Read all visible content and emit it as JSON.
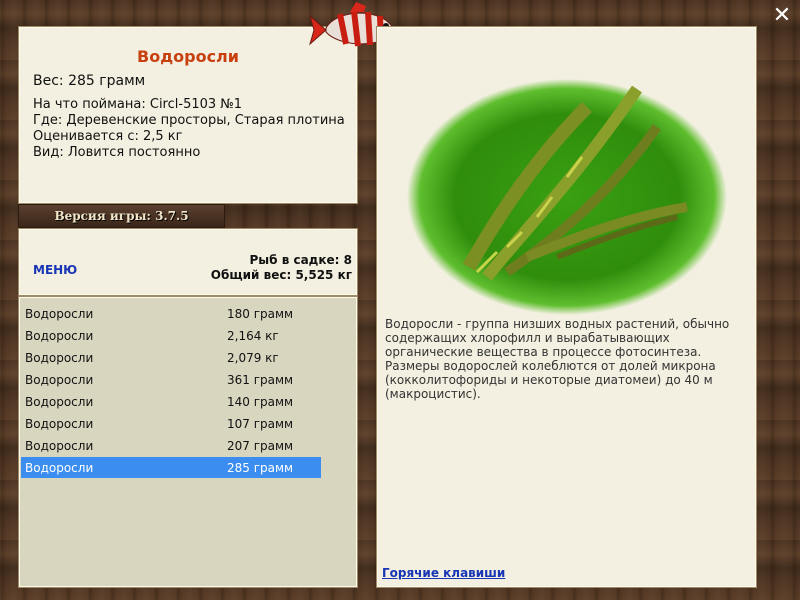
{
  "fish": {
    "title": "Водоросли",
    "weight": "Вес: 285 грамм",
    "caught_with": "На что поймана: Circl-5103 №1",
    "location": "Где: Деревенские просторы, Старая плотина",
    "valued_from": "Оценивается с: 2,5 кг",
    "type": "Вид: Ловится постоянно"
  },
  "version": "Версия игры: 3.7.5",
  "menu": {
    "label": "МЕНЮ",
    "count": "Рыб в садке: 8",
    "total": "Общий вес: 5,525 кг"
  },
  "catch_list": [
    {
      "name": "Водоросли",
      "weight": "180 грамм"
    },
    {
      "name": "Водоросли",
      "weight": "2,164 кг"
    },
    {
      "name": "Водоросли",
      "weight": "2,079 кг"
    },
    {
      "name": "Водоросли",
      "weight": "361 грамм"
    },
    {
      "name": "Водоросли",
      "weight": "140 грамм"
    },
    {
      "name": "Водоросли",
      "weight": "107 грамм"
    },
    {
      "name": "Водоросли",
      "weight": "207 грамм"
    },
    {
      "name": "Водоросли",
      "weight": "285 грамм"
    }
  ],
  "selected_index": 7,
  "description": "Водоросли - группа низших водных растений, обычно содержащих хлорофилл и вырабатывающих органические вещества в процессе фотосинтеза. Размеры водорослей колеблются от долей микрона (кокколитофориды и некоторые диатомеи) до 40 м (макроцистис).",
  "hotkeys": "Горячие клавиши",
  "icons": {
    "close": "close-icon",
    "logo": "fish-logo-icon"
  }
}
